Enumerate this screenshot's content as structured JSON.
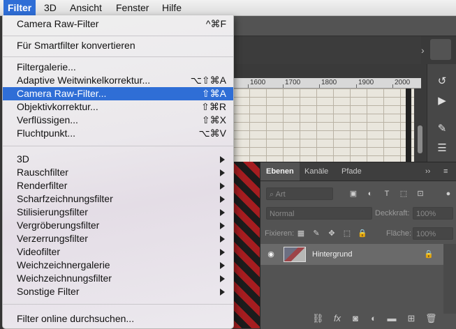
{
  "menubar": {
    "items": [
      "Filter",
      "3D",
      "Ansicht",
      "Fenster",
      "Hilfe"
    ]
  },
  "menu": {
    "items": [
      {
        "label": "Camera Raw-Filter",
        "shortcut": "^⌘F"
      },
      {
        "label": "Für Smartfilter konvertieren",
        "shortcut": ""
      },
      {
        "label": "Filtergalerie...",
        "shortcut": ""
      },
      {
        "label": "Adaptive Weitwinkelkorrektur...",
        "shortcut": "⌥⇧⌘A"
      },
      {
        "label": "Camera Raw-Filter...",
        "shortcut": "⇧⌘A"
      },
      {
        "label": "Objektivkorrektur...",
        "shortcut": "⇧⌘R"
      },
      {
        "label": "Verflüssigen...",
        "shortcut": "⇧⌘X"
      },
      {
        "label": "Fluchtpunkt...",
        "shortcut": "⌥⌘V"
      },
      {
        "label": "3D",
        "shortcut": ""
      },
      {
        "label": "Rauschfilter",
        "shortcut": ""
      },
      {
        "label": "Renderfilter",
        "shortcut": ""
      },
      {
        "label": "Scharfzeichnungsfilter",
        "shortcut": ""
      },
      {
        "label": "Stilisierungsfilter",
        "shortcut": ""
      },
      {
        "label": "Vergröberungsfilter",
        "shortcut": ""
      },
      {
        "label": "Verzerrungsfilter",
        "shortcut": ""
      },
      {
        "label": "Videofilter",
        "shortcut": ""
      },
      {
        "label": "Weichzeichnergalerie",
        "shortcut": ""
      },
      {
        "label": "Weichzeichnungsfilter",
        "shortcut": ""
      },
      {
        "label": "Sonstige Filter",
        "shortcut": ""
      },
      {
        "label": "Filter online durchsuchen...",
        "shortcut": ""
      }
    ],
    "highlighted_index": 4,
    "highlight_color": "#2f6ed6"
  },
  "ruler": {
    "ticks": [
      "1600",
      "1700",
      "1800",
      "1900",
      "2000"
    ]
  },
  "tab": {
    "close_glyph": "›"
  },
  "layers": {
    "tabs": [
      "Ebenen",
      "Kanäle",
      "Pfade"
    ],
    "menu_glyph": "››",
    "filter_placeholder": "Art",
    "blend_mode": "Normal",
    "opacity_label": "Deckkraft:",
    "opacity_value": "100%",
    "lock_label": "Fixieren:",
    "fill_label": "Fläche:",
    "fill_value": "100%",
    "layer_name": "Hintergrund"
  }
}
